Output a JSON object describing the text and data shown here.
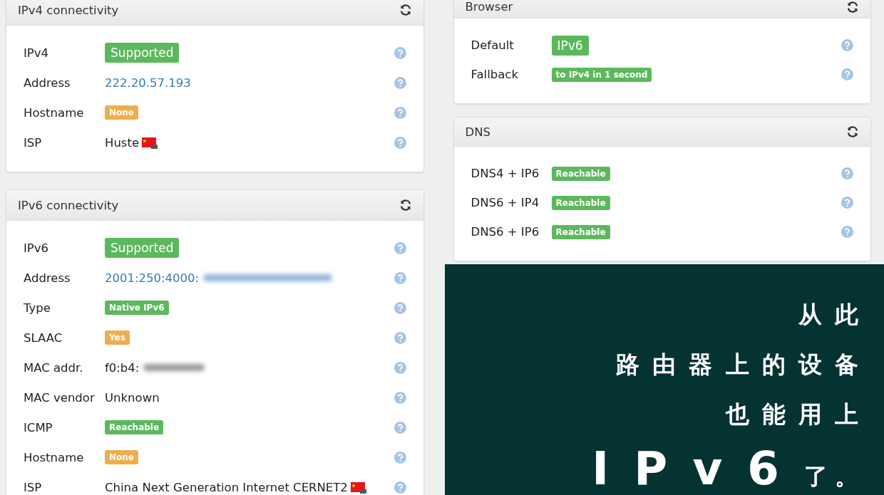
{
  "left_panels": [
    {
      "title": "IPv4 connectivity",
      "rows": [
        {
          "label": "IPv4",
          "value": {
            "kind": "bigbadge",
            "text": "Supported",
            "color": "#5cb85c"
          }
        },
        {
          "label": "Address",
          "value": {
            "kind": "link",
            "text": "222.20.57.193"
          }
        },
        {
          "label": "Hostname",
          "value": {
            "kind": "badge",
            "text": "None",
            "color": "#f0ad4e"
          }
        },
        {
          "label": "ISP",
          "value": {
            "kind": "text",
            "text": "Huste",
            "flag": true
          }
        }
      ]
    },
    {
      "title": "IPv6 connectivity",
      "rows": [
        {
          "label": "IPv6",
          "value": {
            "kind": "bigbadge",
            "text": "Supported",
            "color": "#5cb85c"
          }
        },
        {
          "label": "Address",
          "value": {
            "kind": "link",
            "text": "2001:250:4000:",
            "redacted": true
          }
        },
        {
          "label": "Type",
          "value": {
            "kind": "badge",
            "text": "Native IPv6",
            "color": "#5cb85c"
          }
        },
        {
          "label": "SLAAC",
          "value": {
            "kind": "badge",
            "text": "Yes",
            "color": "#f0ad4e"
          }
        },
        {
          "label": "MAC addr.",
          "value": {
            "kind": "text",
            "text": "f0:b4:",
            "redacted": true
          }
        },
        {
          "label": "MAC vendor",
          "value": {
            "kind": "text",
            "text": "Unknown"
          }
        },
        {
          "label": "ICMP",
          "value": {
            "kind": "badge",
            "text": "Reachable",
            "color": "#5cb85c"
          }
        },
        {
          "label": "Hostname",
          "value": {
            "kind": "badge",
            "text": "None",
            "color": "#f0ad4e"
          }
        },
        {
          "label": "ISP",
          "value": {
            "kind": "text",
            "text": "China Next Generation Internet CERNET2",
            "flag": true
          }
        }
      ]
    }
  ],
  "right_panels": [
    {
      "title": "Browser",
      "rows": [
        {
          "label": "Default",
          "value": {
            "kind": "bigbadge",
            "text": "IPv6",
            "color": "#5cb85c"
          }
        },
        {
          "label": "Fallback",
          "value": {
            "kind": "badge",
            "text": "to IPv4 in 1 second",
            "color": "#5cb85c"
          }
        }
      ]
    },
    {
      "title": "DNS",
      "rows": [
        {
          "label": "DNS4 + IP6",
          "value": {
            "kind": "badge",
            "text": "Reachable",
            "color": "#5cb85c"
          }
        },
        {
          "label": "DNS6 + IP4",
          "value": {
            "kind": "badge",
            "text": "Reachable",
            "color": "#5cb85c"
          }
        },
        {
          "label": "DNS6 + IP6",
          "value": {
            "kind": "badge",
            "text": "Reachable",
            "color": "#5cb85c"
          }
        }
      ]
    }
  ],
  "caption": {
    "lines": [
      "从此",
      "路由器上的设备",
      "也能用上"
    ],
    "headline": "IPv6",
    "tail": "了。"
  }
}
